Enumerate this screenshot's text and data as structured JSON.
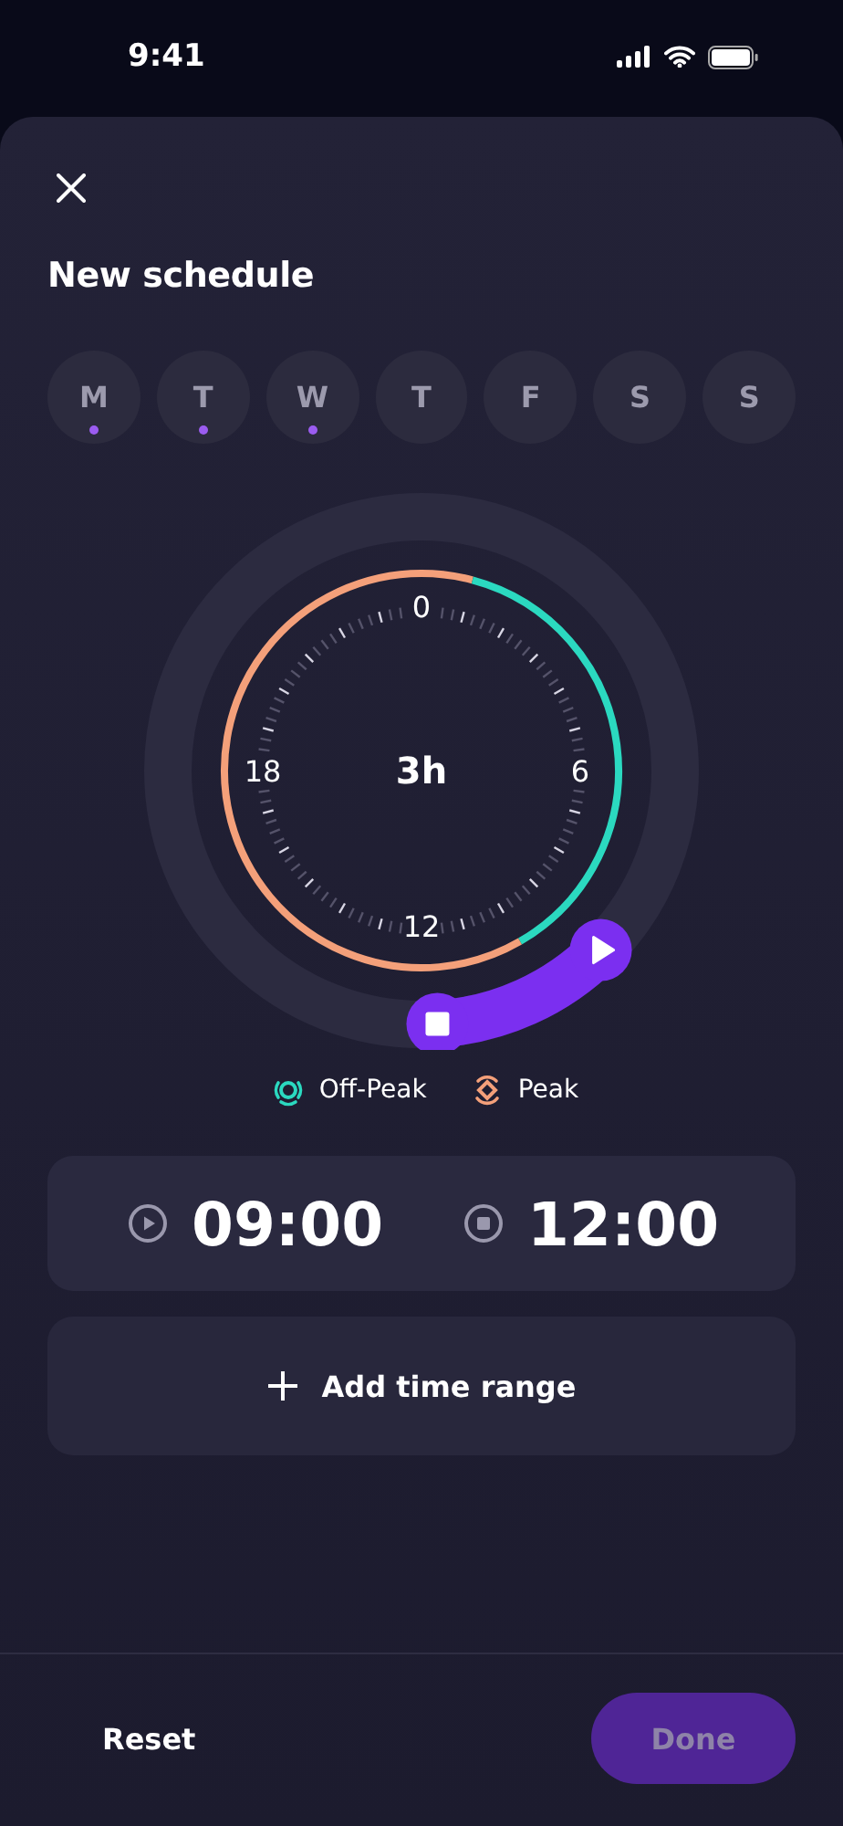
{
  "status_bar": {
    "time": "9:41"
  },
  "title": "New schedule",
  "days": [
    {
      "label": "M",
      "selected": true
    },
    {
      "label": "T",
      "selected": true
    },
    {
      "label": "W",
      "selected": true
    },
    {
      "label": "T",
      "selected": false
    },
    {
      "label": "F",
      "selected": false
    },
    {
      "label": "S",
      "selected": false
    },
    {
      "label": "S",
      "selected": false
    }
  ],
  "dial": {
    "center": "3h",
    "hour_labels": [
      "0",
      "6",
      "12",
      "18"
    ],
    "segments": [
      {
        "kind": "peak"
      },
      {
        "kind": "off_peak"
      },
      {
        "kind": "peak"
      }
    ]
  },
  "legend": [
    {
      "kind": "off_peak",
      "label": "Off-Peak",
      "color": "#2bd9c0"
    },
    {
      "kind": "peak",
      "label": "Peak",
      "color": "#f4a07a"
    }
  ],
  "time_range": {
    "start": "09:00",
    "end": "12:00"
  },
  "add_button": "Add time range",
  "footer": {
    "reset": "Reset",
    "done": "Done",
    "done_disabled": true
  }
}
